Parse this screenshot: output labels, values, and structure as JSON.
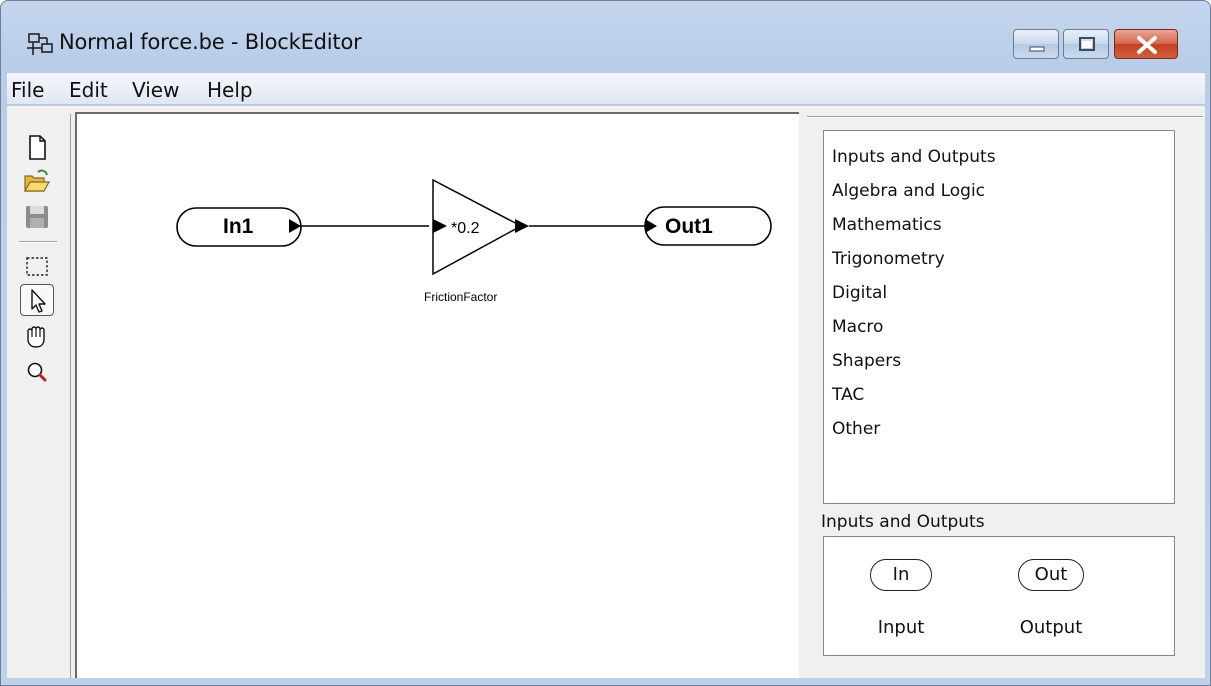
{
  "window": {
    "title": "Normal force.be - BlockEditor",
    "colors": {
      "frame": "#bfd2ec",
      "close_button": "#c2401f"
    }
  },
  "menubar": {
    "items": [
      {
        "label": "File"
      },
      {
        "label": "Edit"
      },
      {
        "label": "View"
      },
      {
        "label": "Help"
      }
    ]
  },
  "toolbar": {
    "tools": [
      {
        "name": "new-file-icon"
      },
      {
        "name": "open-folder-icon"
      },
      {
        "name": "save-icon",
        "disabled": true
      },
      {
        "name": "rectangle-select-icon"
      },
      {
        "name": "pointer-icon",
        "active": true
      },
      {
        "name": "hand-pan-icon"
      },
      {
        "name": "zoom-icon"
      }
    ]
  },
  "diagram": {
    "blocks": {
      "input": {
        "label": "In1",
        "type": "input"
      },
      "gain": {
        "label": "*0.2",
        "caption": "FrictionFactor",
        "type": "gain"
      },
      "output": {
        "label": "Out1",
        "type": "output"
      }
    },
    "connections": [
      {
        "from": "In1",
        "to": "FrictionFactor"
      },
      {
        "from": "FrictionFactor",
        "to": "Out1"
      }
    ]
  },
  "library": {
    "categories": [
      "Inputs and Outputs",
      "Algebra and Logic",
      "Mathematics",
      "Trigonometry",
      "Digital",
      "Macro",
      "Shapers",
      "TAC",
      "Other"
    ],
    "selected_category": "Inputs and Outputs",
    "palette": [
      {
        "symbol": "In",
        "caption": "Input"
      },
      {
        "symbol": "Out",
        "caption": "Output"
      }
    ]
  }
}
